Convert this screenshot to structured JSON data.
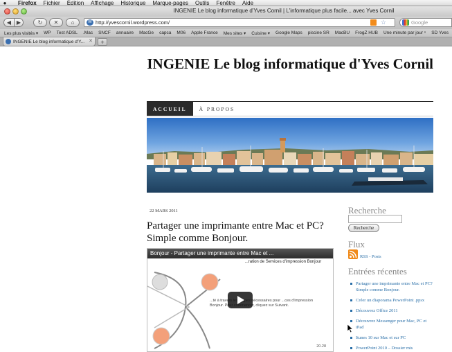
{
  "menubar": {
    "app": "Firefox",
    "items": [
      "Fichier",
      "Édition",
      "Affichage",
      "Historique",
      "Marque-pages",
      "Outils",
      "Fenêtre",
      "Aide"
    ]
  },
  "window": {
    "title": "INGENIE Le blog informatique d'Yves Cornil | L'informatique plus facile... avec Yves Cornil"
  },
  "navbar": {
    "url": "http://yvescornil.wordpress.com/",
    "search_placeholder": "Google"
  },
  "bookmarks": [
    "Les plus visités ▾",
    "WP",
    "Test ADSL",
    ".Mac",
    "SNCF",
    "annuaire",
    "MacGe",
    "capca",
    "M06",
    "Apple France",
    "Mes sites ▾",
    "Cuisine ▾",
    "Google Maps",
    "piscine SR",
    "MacBU",
    "FrogZ HUB",
    "Une minute par jour ⁿ",
    "SD Yves"
  ],
  "tab": {
    "title": "INGENIE Le blog informatique d'Y...",
    "new_tab": "+"
  },
  "site": {
    "title": "INGENIE Le blog informatique d'Yves Cornil",
    "nav": [
      "ACCUEIL",
      "À PROPOS"
    ]
  },
  "post": {
    "date": "22 MARS 2011",
    "title": "Partager une imprimante entre Mac et PC? Simple comme Bonjour.",
    "video_title": "Bonjour - Partager une imprimante entre Mac et ...",
    "video_subtitle": "...ration de Services d'impression Bonjour",
    "video_text": "...té à travers les étapes nécessaires pour ...ces d'impression Bonjour. Pour commencer, cliquez sur Suivant.",
    "video_counter": "20.28"
  },
  "sidebar": {
    "search_title": "Recherche",
    "search_button": "Recherche",
    "flux_title": "Flux",
    "rss_link": "RSS - Posts",
    "recent_title": "Entrées récentes",
    "recent": [
      "Partager une imprimante entre Mac et PC? Simple comme Bonjour.",
      "Créer un diaporama PowerPoint .ppsx",
      "Découvrez Office 2011",
      "Découvrez Messenger pour Mac, PC et iPad",
      "Itunes 10 sur Mac et sur PC",
      "PowerPoint 2010 – Dossier mis"
    ]
  },
  "colors": {
    "link": "#2a6fa8",
    "nav_active_bg": "#2b2b2b",
    "widget_title": "#888888"
  }
}
